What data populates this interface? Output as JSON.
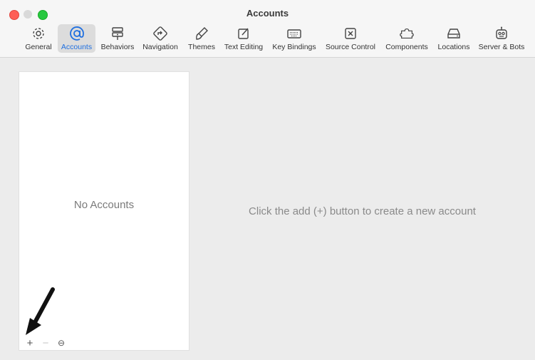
{
  "window": {
    "title": "Accounts"
  },
  "toolbar": {
    "items": [
      {
        "label": "General",
        "icon": "gear-icon"
      },
      {
        "label": "Accounts",
        "icon": "at-sign-icon"
      },
      {
        "label": "Behaviors",
        "icon": "behaviors-icon"
      },
      {
        "label": "Navigation",
        "icon": "navigation-icon"
      },
      {
        "label": "Themes",
        "icon": "paintbrush-icon"
      },
      {
        "label": "Text Editing",
        "icon": "pencil-square-icon"
      },
      {
        "label": "Key Bindings",
        "icon": "keyboard-icon"
      },
      {
        "label": "Source Control",
        "icon": "source-control-icon"
      },
      {
        "label": "Components",
        "icon": "puzzle-icon"
      },
      {
        "label": "Locations",
        "icon": "drive-icon"
      },
      {
        "label": "Server & Bots",
        "icon": "robot-icon"
      }
    ],
    "active": "Accounts",
    "accent_color": "#1f6fe0"
  },
  "accounts_list": {
    "empty_text": "No Accounts",
    "add_label": "+",
    "remove_label": "−",
    "options_label": "⊖"
  },
  "detail": {
    "empty_text": "Click the add (+) button to create a new account"
  }
}
